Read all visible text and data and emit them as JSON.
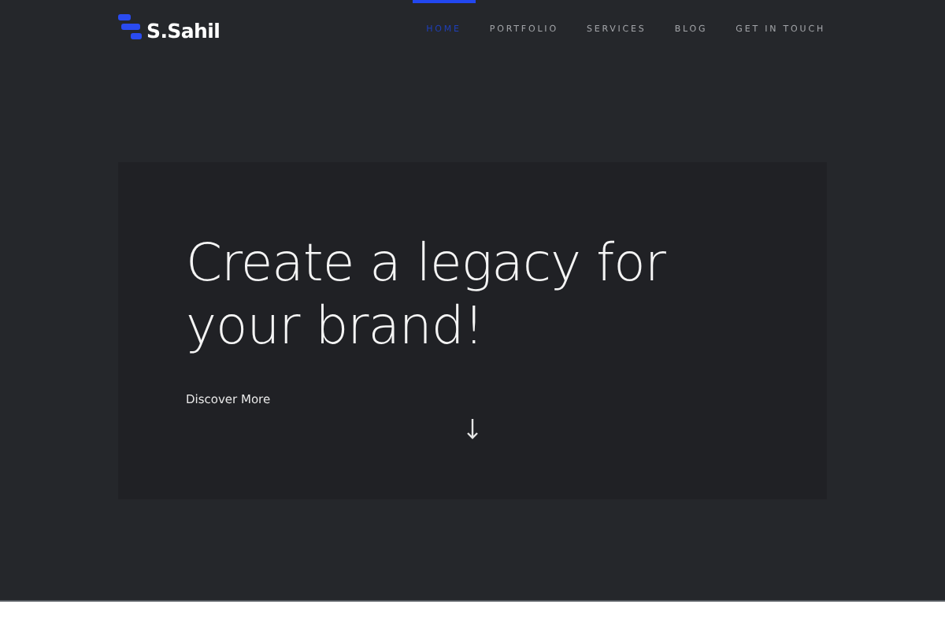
{
  "brand": {
    "name": "S.Sahil"
  },
  "nav": [
    {
      "label": "HOME",
      "selected": true
    },
    {
      "label": "PORTFOLIO",
      "selected": false
    },
    {
      "label": "SERVICES",
      "selected": false
    },
    {
      "label": "BLOG",
      "selected": false
    },
    {
      "label": "GET IN TOUCH",
      "selected": false
    }
  ],
  "hero": {
    "title": "Create a legacy for your brand!",
    "link": "Discover More"
  }
}
